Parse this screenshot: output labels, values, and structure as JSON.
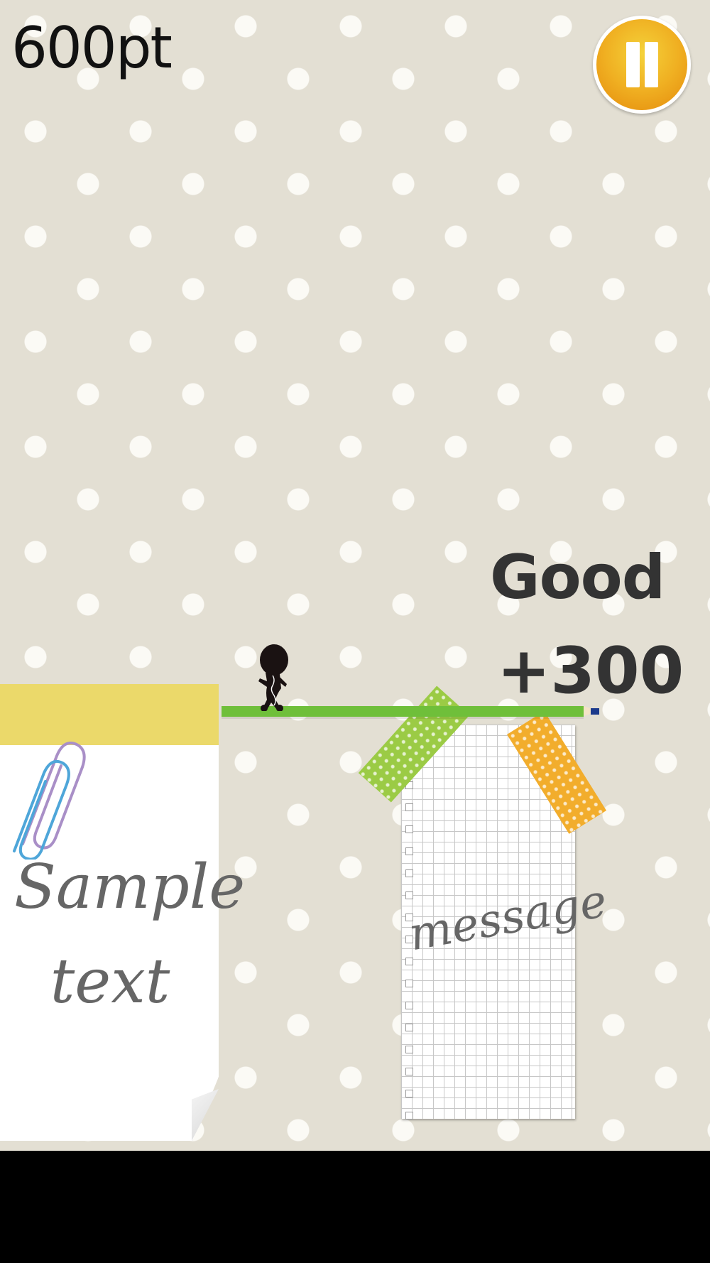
{
  "hud": {
    "score": "600pt",
    "pause_icon": "pause-icon"
  },
  "feedback": {
    "rating": "Good",
    "bonus": "+300"
  },
  "notes": {
    "sticky_text_line1": "Sample",
    "sticky_text_line2": "text",
    "grid_text": "message"
  },
  "colors": {
    "background": "#e3dfd3",
    "dots": "#fbfaf5",
    "pause_button": "#f0b022",
    "line": "#6fbf3a",
    "sticky_top": "#ebd96a",
    "tape_green": "#9bcb45",
    "tape_orange": "#f2ad2c"
  }
}
